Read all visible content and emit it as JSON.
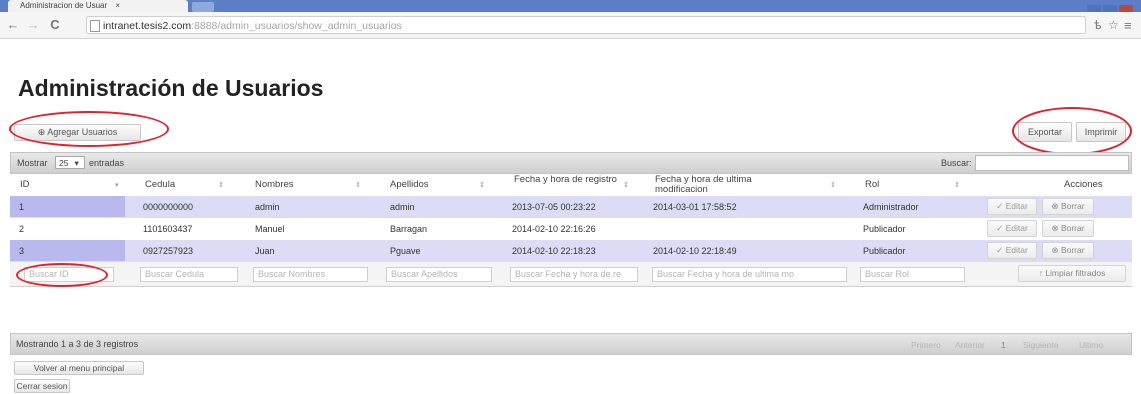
{
  "browser": {
    "tab_title": "Administracion de Usuar",
    "tab_close": "×",
    "url_host": "intranet.tesis2.com",
    "url_rest": ":8888/admin_usuarios/show_admin_usuarios",
    "back_icon": "←",
    "forward_icon": "→",
    "reload_icon": "C",
    "star_icon": "☆",
    "menu_icon": "≡",
    "translate_icon": "ѣ"
  },
  "page": {
    "title": "Administración de Usuarios"
  },
  "toolbar": {
    "add_users_label": "Agregar Usuarios",
    "add_icon": "⊕",
    "export_label": "Exportar",
    "print_label": "Imprimir"
  },
  "table_controls": {
    "show_label": "Mostrar",
    "entries_value": "25",
    "entries_label": "entradas",
    "search_label": "Buscar:",
    "search_value": ""
  },
  "table": {
    "columns": [
      "ID",
      "Cedula",
      "Nombres",
      "Apellidos",
      "Fecha y hora de registro",
      "Fecha y hora de ultima modificacion",
      "Rol",
      "Acciones"
    ],
    "rows": [
      {
        "id": "1",
        "cedula": "0000000000",
        "nombres": "admin",
        "apellidos": "admin",
        "registro": "2013-07-05 00:23:22",
        "modificacion": "2014-03-01 17:58:52",
        "rol": "Administrador"
      },
      {
        "id": "2",
        "cedula": "1101603437",
        "nombres": "Manuel",
        "apellidos": "Barragan",
        "registro": "2014-02-10 22:16:26",
        "modificacion": "",
        "rol": "Publicador"
      },
      {
        "id": "3",
        "cedula": "0927257923",
        "nombres": "Juan",
        "apellidos": "Pguave",
        "registro": "2014-02-10 22:18:23",
        "modificacion": "2014-02-10 22:18:49",
        "rol": "Publicador"
      }
    ],
    "edit_label": "Editar",
    "delete_label": "Borrar",
    "edit_icon": "✓",
    "delete_icon": "⊗"
  },
  "filters": {
    "id_placeholder": "Buscar ID",
    "cedula_placeholder": "Buscar Cedula",
    "nombres_placeholder": "Buscar Nombres",
    "apellidos_placeholder": "Buscar Apellidos",
    "registro_placeholder": "Buscar Fecha y hora de re",
    "modificacion_placeholder": "Buscar Fecha y hora de ultima mo",
    "rol_placeholder": "Buscar Rol",
    "clear_label": "Limpiar filtrados",
    "clear_icon": "↑"
  },
  "footer": {
    "info": "Mostrando 1 a 3 de 3 registros",
    "first": "Primero",
    "prev": "Anterior",
    "page": "1",
    "next": "Siguiente",
    "last": "Ultimo",
    "back_menu_label": "Volver al menu principal",
    "logout_label": "Cerrar sesion"
  }
}
